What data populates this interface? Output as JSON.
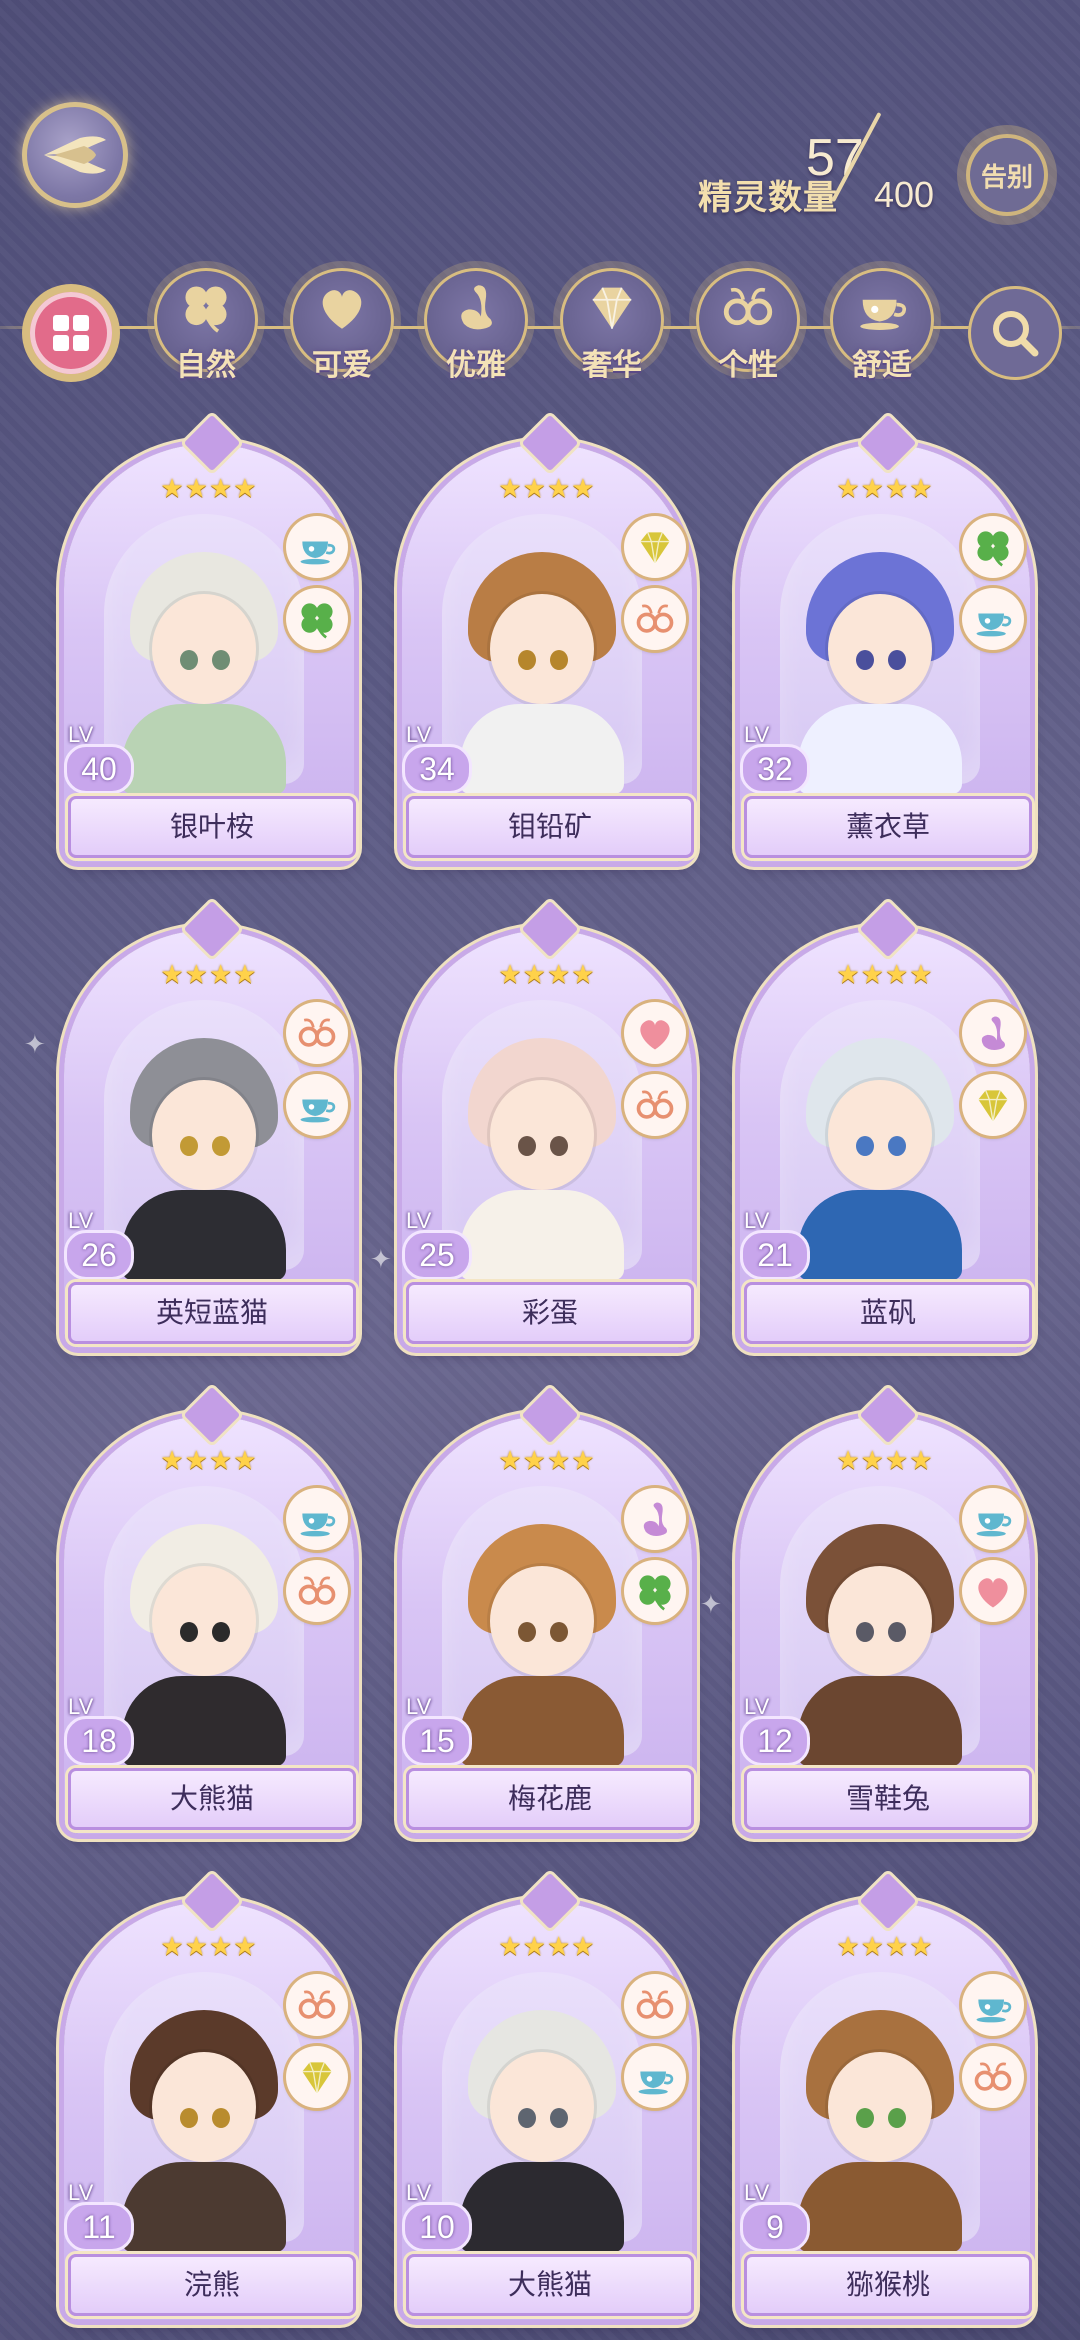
{
  "header": {
    "count_label": "精灵数量",
    "count_current": "57",
    "count_max": "400",
    "farewell_label": "告别"
  },
  "filters": [
    {
      "label": "自然",
      "icon": "clover-icon"
    },
    {
      "label": "可爱",
      "icon": "heart-icon"
    },
    {
      "label": "优雅",
      "icon": "swan-icon"
    },
    {
      "label": "奢华",
      "icon": "diamond-icon"
    },
    {
      "label": "个性",
      "icon": "glasses-icon"
    },
    {
      "label": "舒适",
      "icon": "teacup-icon"
    }
  ],
  "lv_prefix": "LV",
  "cards": [
    {
      "name": "银叶桉",
      "level": "40",
      "stars": 4,
      "tags": [
        "teacup",
        "clover"
      ],
      "hair": "#e8e7e0",
      "accent": "#b9d3b4",
      "eye": "#6f8d74"
    },
    {
      "name": "钼铅矿",
      "level": "34",
      "stars": 4,
      "tags": [
        "diamond",
        "glasses"
      ],
      "hair": "#b97d45",
      "accent": "#f1f1f1",
      "eye": "#b6862c"
    },
    {
      "name": "薰衣草",
      "level": "32",
      "stars": 4,
      "tags": [
        "clover",
        "teacup"
      ],
      "hair": "#6c73d6",
      "accent": "#eef0ff",
      "eye": "#4a4f9c"
    },
    {
      "name": "英短蓝猫",
      "level": "26",
      "stars": 4,
      "tags": [
        "glasses",
        "teacup"
      ],
      "hair": "#8e8f96",
      "accent": "#2d2d33",
      "eye": "#c29a35"
    },
    {
      "name": "彩蛋",
      "level": "25",
      "stars": 4,
      "tags": [
        "heart",
        "glasses"
      ],
      "hair": "#f2d6cf",
      "accent": "#f6f1e9",
      "eye": "#6a5448"
    },
    {
      "name": "蓝矾",
      "level": "21",
      "stars": 4,
      "tags": [
        "swan",
        "diamond"
      ],
      "hair": "#dfe6ec",
      "accent": "#2e67b3",
      "eye": "#4a78c2"
    },
    {
      "name": "大熊猫",
      "level": "18",
      "stars": 4,
      "tags": [
        "teacup",
        "glasses"
      ],
      "hair": "#f1ede4",
      "accent": "#2f2b2e",
      "eye": "#2b2b2b"
    },
    {
      "name": "梅花鹿",
      "level": "15",
      "stars": 4,
      "tags": [
        "swan",
        "clover"
      ],
      "hair": "#c98a4c",
      "accent": "#8a5a34",
      "eye": "#7c5734"
    },
    {
      "name": "雪鞋兔",
      "level": "12",
      "stars": 4,
      "tags": [
        "teacup",
        "heart"
      ],
      "hair": "#7b5138",
      "accent": "#6b4630",
      "eye": "#5a5a66"
    },
    {
      "name": "浣熊",
      "level": "11",
      "stars": 4,
      "tags": [
        "glasses",
        "diamond"
      ],
      "hair": "#5b3a2a",
      "accent": "#4c3a31",
      "eye": "#b98c2e"
    },
    {
      "name": "大熊猫",
      "level": "10",
      "stars": 4,
      "tags": [
        "glasses",
        "teacup"
      ],
      "hair": "#e6e6e2",
      "accent": "#2c2a30",
      "eye": "#5e6570"
    },
    {
      "name": "猕猴桃",
      "level": "9",
      "stars": 4,
      "tags": [
        "teacup",
        "glasses"
      ],
      "hair": "#a8713f",
      "accent": "#8a5a32",
      "eye": "#5aa04a"
    }
  ]
}
